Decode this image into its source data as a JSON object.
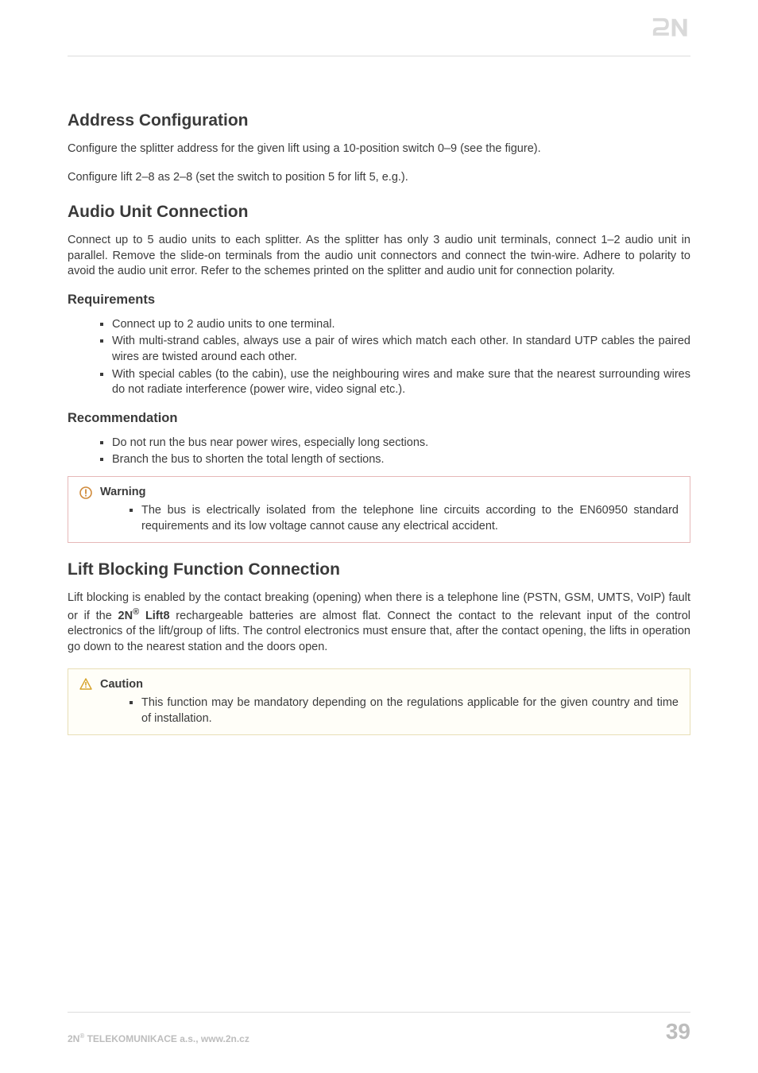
{
  "logo_alt": "2N",
  "sections": {
    "address": {
      "title": "Address Configuration",
      "p1": "Configure the splitter address for the given lift using a 10-position switch 0–9 (see the figure).",
      "p2": "Configure lift 2–8 as 2–8 (set the switch to position 5 for lift 5, e.g.)."
    },
    "audio": {
      "title": "Audio Unit Connection",
      "p1": "Connect up to 5 audio units to each splitter. As the splitter has only 3 audio unit terminals, connect 1–2 audio unit in parallel.  Remove the slide-on terminals from the audio unit connectors and connect the twin-wire. Adhere to polarity to avoid the audio unit error. Refer to the schemes printed on the splitter and audio unit for connection polarity.",
      "req_title": "Requirements",
      "req_items": [
        "Connect up to 2 audio units to one terminal.",
        "With multi-strand cables, always use a pair of wires which match each other. In standard UTP cables the paired wires are twisted around each other.",
        "With special cables (to the cabin), use the neighbouring wires and make sure that the nearest surrounding wires do not radiate interference (power wire, video signal etc.)."
      ],
      "rec_title": "Recommendation",
      "rec_items": [
        "Do not run the bus near power wires, especially long sections.",
        "Branch the bus to shorten the total length of sections."
      ]
    },
    "warning": {
      "label": "Warning",
      "item": "The bus is electrically isolated from the telephone line circuits according to the EN60950 standard requirements and its low voltage cannot cause any electrical accident."
    },
    "lift": {
      "title": "Lift Blocking Function Connection",
      "p1_a": "Lift blocking is enabled by the contact breaking (opening) when there is a telephone line (PSTN, GSM, UMTS, VoIP) fault or if the ",
      "p1_brand_prefix": "2N",
      "p1_brand_suffix": " Lift8",
      "p1_b": " rechargeable batteries are almost flat. Connect the contact to the relevant input of the control electronics of the lift/group of lifts. The control electronics must ensure that, after the contact opening, the lifts in operation go down to the nearest station and the doors open."
    },
    "caution": {
      "label": "Caution",
      "item": "This function may be mandatory depending on the regulations applicable for the given country and time of installation."
    }
  },
  "footer": {
    "company_prefix": "2N",
    "company_suffix": " TELEKOMUNIKACE a.s., www.2n.cz",
    "page": "39"
  }
}
